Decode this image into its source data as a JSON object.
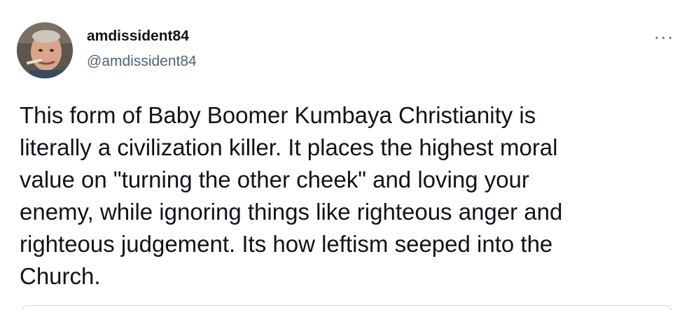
{
  "author": {
    "display_name": "amdissident84",
    "handle": "@amdissident84",
    "avatar_icon": "avatar-photo"
  },
  "tweet": {
    "text": "This form of Baby Boomer Kumbaya Christianity is\nliterally a civilization killer. It places the highest moral\nvalue on \"turning the other cheek\" and loving your\nenemy, while ignoring things like righteous anger and\nrighteous judgement. Its how leftism seeped into the\nChurch."
  },
  "menu": {
    "more_icon": "more-horizontal-icon",
    "more_glyph": "···"
  },
  "colors": {
    "text_primary": "#0f1419",
    "text_secondary": "#536471",
    "border": "#cfd9de"
  }
}
